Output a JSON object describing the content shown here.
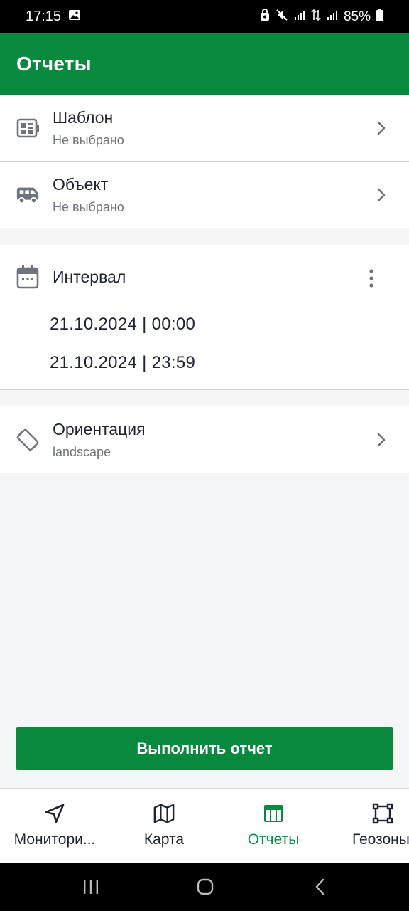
{
  "status_bar": {
    "time": "17:15",
    "battery": "85%"
  },
  "app_bar": {
    "title": "Отчеты"
  },
  "rows": {
    "template": {
      "title": "Шаблон",
      "value": "Не выбрано",
      "icon": "template-icon"
    },
    "object": {
      "title": "Объект",
      "value": "Не выбрано",
      "icon": "van-icon"
    },
    "orientation": {
      "title": "Ориентация",
      "value": "landscape",
      "icon": "rotate-screen-icon"
    }
  },
  "interval": {
    "title": "Интервал",
    "from": "21.10.2024 | 00:00",
    "to": "21.10.2024 | 23:59"
  },
  "run_button": {
    "label": "Выполнить отчет"
  },
  "bottom_nav": {
    "items": [
      {
        "label": "Монитори...",
        "icon": "navigation-arrow-icon",
        "active": false
      },
      {
        "label": "Карта",
        "icon": "map-icon",
        "active": false
      },
      {
        "label": "Отчеты",
        "icon": "table-icon",
        "active": true
      },
      {
        "label": "Геозоны",
        "icon": "geofence-square-icon",
        "active": false
      }
    ]
  },
  "colors": {
    "primary": "#08893d",
    "text": "#1f2433",
    "muted": "#6e737d",
    "background": "#f4f5f7"
  }
}
